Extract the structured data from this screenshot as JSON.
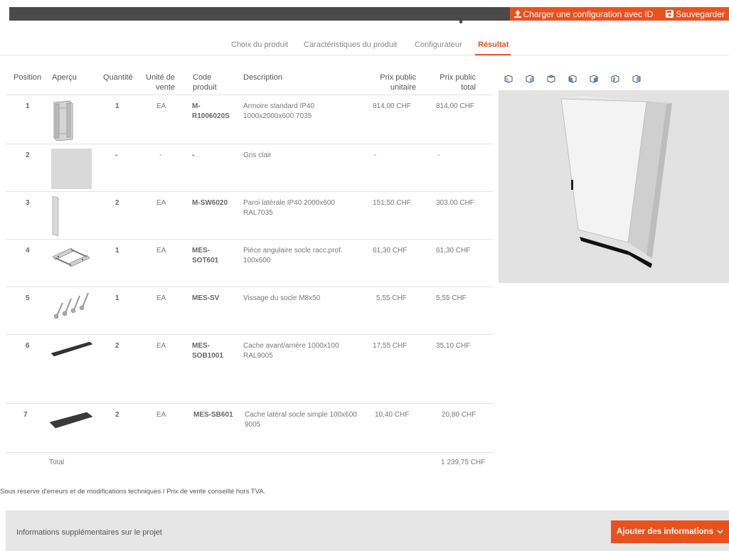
{
  "toolbar": {
    "load_label": "Charger une configuration avec ID",
    "save_label": "Sauvegarder"
  },
  "tabs": [
    {
      "label": "Choix du produit",
      "active": false
    },
    {
      "label": "Caractéristiques du produit",
      "active": false
    },
    {
      "label": "Configurateur",
      "active": false
    },
    {
      "label": "Résultat",
      "active": true
    }
  ],
  "table": {
    "headers": {
      "position": "Position",
      "apercu": "Aperçu",
      "quantite": "Quantité",
      "unite_1": "Unité de",
      "unite_2": "vente",
      "code_1": "Code",
      "code_2": "produit",
      "description": "Description",
      "prix_unit_1": "Prix public",
      "prix_unit_2": "unitaire",
      "prix_total_1": "Prix public",
      "prix_total_2": "total"
    },
    "rows": [
      {
        "position": "1",
        "quantite": "1",
        "unite": "EA",
        "code_1": "M-",
        "code_2": "R1006020S",
        "description_1": "Armoire standard IP40",
        "description_2": "1000x2000x600 7035",
        "prix_unitaire": "814,00 CHF",
        "prix_total": "814,00 CHF",
        "thumb": "cabinet-frame"
      },
      {
        "position": "2",
        "quantite": "-",
        "unite": "-",
        "code_1": "-",
        "code_2": "",
        "description_1": "Gris clair",
        "description_2": "",
        "prix_unitaire": "-",
        "prix_total": "-",
        "thumb": "color-swatch"
      },
      {
        "position": "3",
        "quantite": "2",
        "unite": "EA",
        "code_1": "M-SW6020",
        "code_2": "",
        "description_1": "Paroi latérale IP40 2000x600",
        "description_2": "RAL7035",
        "prix_unitaire": "151,50 CHF",
        "prix_total": "303,00 CHF",
        "thumb": "side-panel"
      },
      {
        "position": "4",
        "quantite": "1",
        "unite": "EA",
        "code_1": "MES-",
        "code_2": "SOT601",
        "description_1": "Pièce angulaire socle racc.prof.",
        "description_2": "100x600",
        "prix_unitaire": "61,30 CHF",
        "prix_total": "61,30 CHF",
        "thumb": "plinth-corner"
      },
      {
        "position": "5",
        "quantite": "1",
        "unite": "EA",
        "code_1": "MES-SV",
        "code_2": "",
        "description_1": "Vissage du socle M8x50",
        "description_2": "",
        "prix_unitaire": "5,55 CHF",
        "prix_total": "5,55 CHF",
        "thumb": "bolts"
      },
      {
        "position": "6",
        "quantite": "2",
        "unite": "EA",
        "code_1": "MES-",
        "code_2": "SOB1001",
        "description_1": "Cache avant/arrière 1000x100",
        "description_2": "RAL9005",
        "prix_unitaire": "17,55 CHF",
        "prix_total": "35,10 CHF",
        "thumb": "cover-strip"
      },
      {
        "position": "7",
        "quantite": "2",
        "unite": "EA",
        "code_1": "MES-SB601",
        "code_2": "",
        "description_1": "Cache latéral socle simple 100x600",
        "description_2": "9005",
        "prix_unitaire": "10,40 CHF",
        "prix_total": "20,80 CHF",
        "thumb": "side-cover"
      }
    ],
    "total_label": "Total",
    "total_value": "1 239,75 CHF"
  },
  "footnote": "Sous réserve d'erreurs et de modifications techniques / Prix de vente conseillé hors TVA.",
  "info": {
    "label": "Informations supplémentaires sur le projet",
    "button_label": "Ajouter des informations"
  },
  "viewer": {
    "view_icons": [
      "view-iso-1-icon",
      "view-iso-2-icon",
      "view-iso-3-icon",
      "view-iso-4-icon",
      "view-iso-5-icon",
      "view-iso-6-icon",
      "view-iso-7-icon"
    ]
  },
  "colors": {
    "accent": "#e8521f",
    "header_bar": "#4a4a4a",
    "info_bar": "#e6e6e6",
    "viewer_bg": "#e2e2e2",
    "view_icon": "#2a6fb0"
  }
}
